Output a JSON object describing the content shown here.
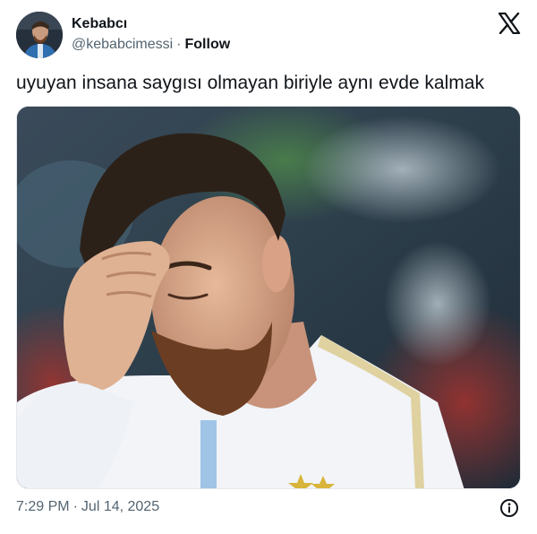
{
  "tweet": {
    "author_name": "Kebabcı",
    "author_handle": "@kebabcimessi",
    "separator": "·",
    "follow_label": "Follow",
    "text": "uyuyan insana saygısı olmayan biriyle aynı evde kalmak",
    "time": "7:29 PM",
    "date": "Jul 14, 2025"
  },
  "icons": {
    "platform_logo": "x-logo-icon",
    "info": "info-icon"
  },
  "colors": {
    "text_primary": "#0f1419",
    "text_secondary": "#536471",
    "jersey": "#f2f4f8",
    "stars": "#d8b43a"
  }
}
